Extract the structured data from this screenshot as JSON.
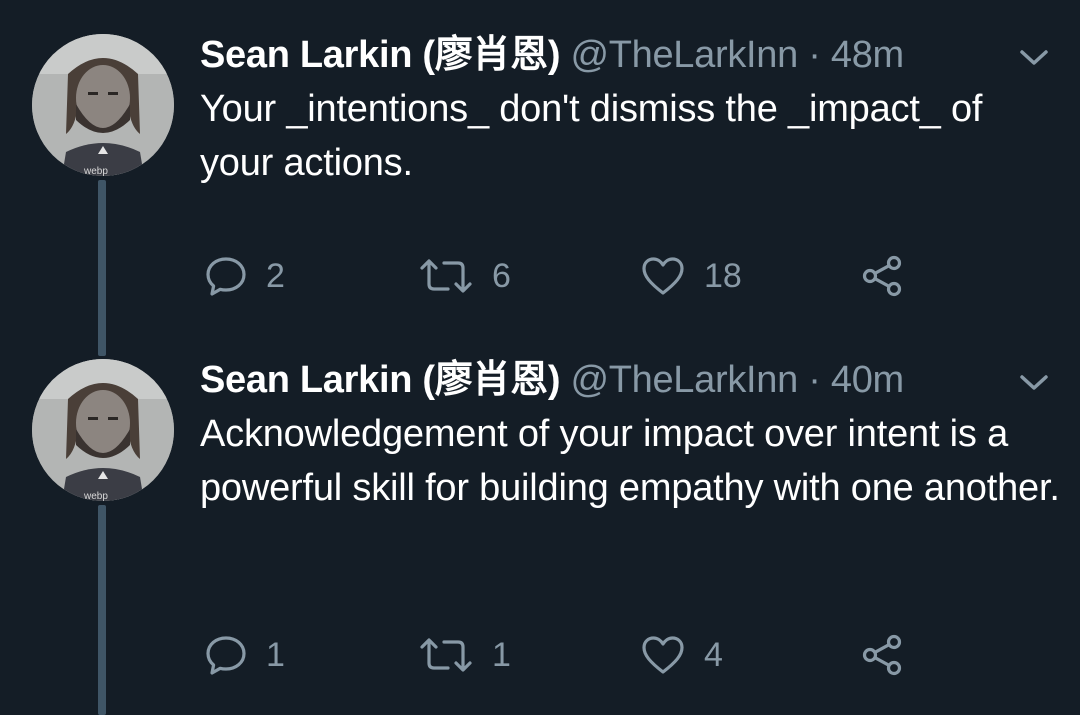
{
  "tweets": [
    {
      "author": "Sean Larkin (廖肖恩)",
      "handle": "@TheLarkInn",
      "separator": "·",
      "time": "48m",
      "text": "Your _intentions_ don't dismiss the _impact_ of your actions.",
      "replies": "2",
      "retweets": "6",
      "likes": "18"
    },
    {
      "author": "Sean Larkin (廖肖恩)",
      "handle": "@TheLarkInn",
      "separator": "·",
      "time": "40m",
      "text": "Acknowledgement of your impact over intent is a powerful skill for building empathy with one another.",
      "replies": "1",
      "retweets": "1",
      "likes": "4"
    }
  ],
  "icons": {
    "reply": "reply-icon",
    "retweet": "retweet-icon",
    "like": "heart-icon",
    "share": "share-icon",
    "menu": "chevron-down-icon"
  },
  "colors": {
    "background": "#141d26",
    "secondary_text": "#8899a6",
    "thread_line": "#3f5566"
  }
}
